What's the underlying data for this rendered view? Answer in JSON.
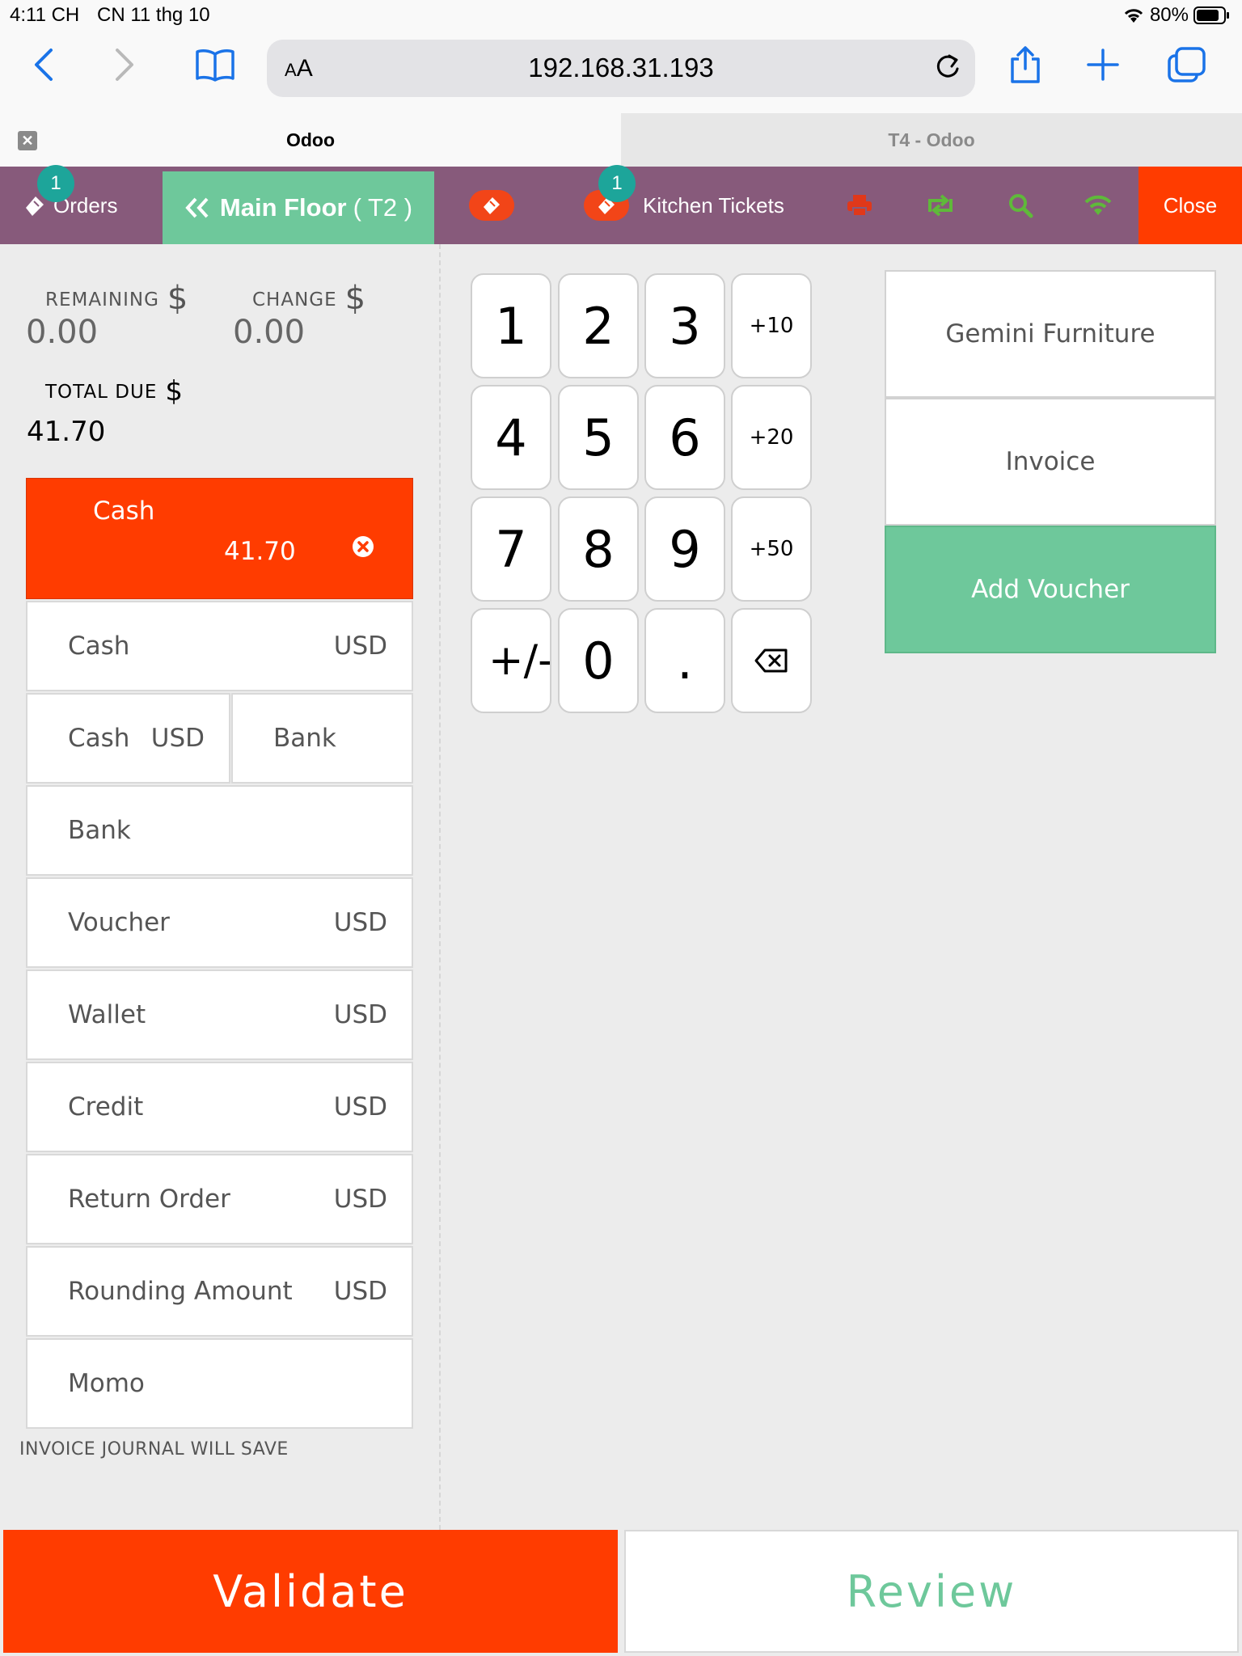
{
  "status_bar": {
    "time": "4:11 CH",
    "date": "CN 11 thg 10",
    "battery": "80%"
  },
  "browser": {
    "aa_small": "A",
    "aa_large": "A",
    "url": "192.168.31.193"
  },
  "tabs": [
    {
      "title": "Odoo",
      "active": true
    },
    {
      "title": "T4 - Odoo",
      "active": false
    }
  ],
  "header": {
    "orders_label": "Orders",
    "orders_badge": "1",
    "floor_name": "Main Floor",
    "table_name": "( T2 )",
    "kitchen_label": "Kitchen Tickets",
    "kitchen_badge": "1",
    "close_label": "Close",
    "colors": {
      "bar": "#875a7b",
      "floor": "#6ec89b",
      "accent": "#ff3c00",
      "icon_green": "#5fb93a",
      "icon_red": "#e0381a"
    }
  },
  "summary": {
    "remaining_label": "REMAINING",
    "remaining_currency": "$",
    "remaining_value": "0.00",
    "change_label": "CHANGE",
    "change_currency": "$",
    "change_value": "0.00",
    "total_due_label": "TOTAL DUE",
    "total_due_currency": "$",
    "total_due_value": "41.70"
  },
  "paid_line": {
    "method": "Cash",
    "amount": "41.70"
  },
  "payment_methods": [
    {
      "name": "Cash",
      "currency": "USD"
    },
    {
      "name": "Cash",
      "currency": "USD"
    },
    {
      "name": "Bank",
      "currency": ""
    },
    {
      "name": "Bank",
      "currency": ""
    },
    {
      "name": "Voucher",
      "currency": "USD"
    },
    {
      "name": "Wallet",
      "currency": "USD"
    },
    {
      "name": "Credit",
      "currency": "USD"
    },
    {
      "name": "Return Order",
      "currency": "USD"
    },
    {
      "name": "Rounding Amount",
      "currency": "USD"
    },
    {
      "name": "Momo",
      "currency": ""
    }
  ],
  "journal_note": "INVOICE JOURNAL WILL SAVE",
  "numpad": {
    "k1": "1",
    "k2": "2",
    "k3": "3",
    "plus10": "+10",
    "k4": "4",
    "k5": "5",
    "k6": "6",
    "plus20": "+20",
    "k7": "7",
    "k8": "8",
    "k9": "9",
    "plus50": "+50",
    "sign": "+/-",
    "k0": "0",
    "dot": ".",
    "backspace_icon": "backspace-icon"
  },
  "side_buttons": {
    "customer": "Gemini Furniture",
    "invoice": "Invoice",
    "voucher": "Add Voucher"
  },
  "bottom": {
    "validate": "Validate",
    "review": "Review"
  }
}
